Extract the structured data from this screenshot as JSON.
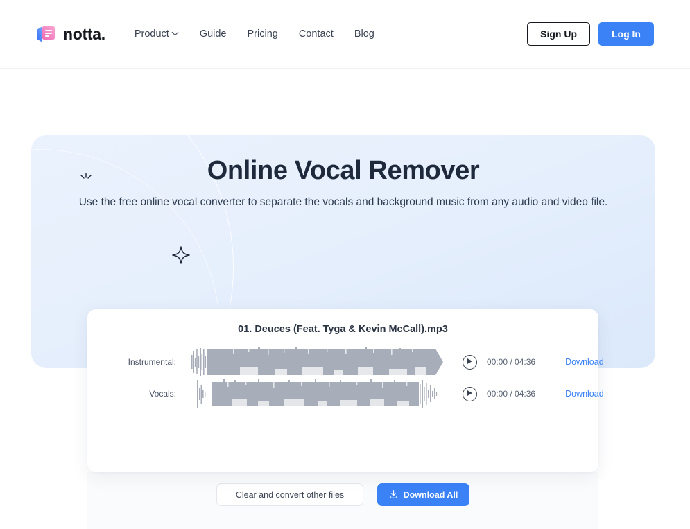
{
  "header": {
    "brand_name": "notta.",
    "nav": [
      {
        "label": "Product",
        "has_caret": true
      },
      {
        "label": "Guide",
        "has_caret": false
      },
      {
        "label": "Pricing",
        "has_caret": false
      },
      {
        "label": "Contact",
        "has_caret": false
      },
      {
        "label": "Blog",
        "has_caret": false
      }
    ],
    "signup_label": "Sign Up",
    "login_label": "Log In"
  },
  "hero": {
    "title": "Online Vocal Remover",
    "subtitle": "Use the free online vocal converter to separate the vocals and background music from any audio and video file."
  },
  "player": {
    "file_name": "01. Deuces (Feat. Tyga & Kevin McCall).mp3",
    "tracks": [
      {
        "label": "Instrumental:",
        "time": "00:00 / 04:36",
        "download_label": "Download"
      },
      {
        "label": "Vocals:",
        "time": "00:00 / 04:36",
        "download_label": "Download"
      }
    ]
  },
  "footer_actions": {
    "clear_label": "Clear and convert other files",
    "download_all_label": "Download All"
  },
  "colors": {
    "accent_blue": "#3b82f6",
    "hero_bg": "#e6effc",
    "text_dark": "#1e293b",
    "waveform_gray": "#a8aeb9"
  }
}
